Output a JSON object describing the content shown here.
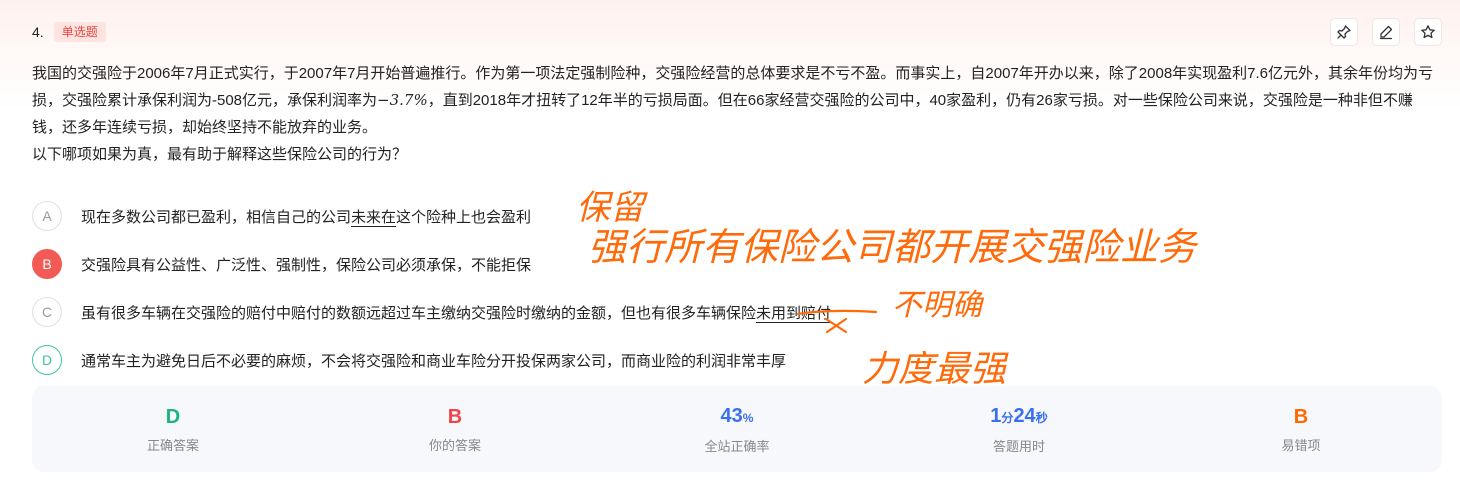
{
  "question": {
    "number": "4.",
    "type": "单选题",
    "stem_before_math": "我国的交强险于2006年7月正式实行，于2007年7月开始普遍推行。作为第一项法定强制险种，交强险经营的总体要求是不亏不盈。而事实上，自2007年开办以来，除了2008年实现盈利7.6亿元外，其余年份均为亏损，交强险累计承保利润为-508亿元，承保利润率为",
    "stem_math": "−3.7%",
    "stem_after_math": "，直到2018年才扭转了12年半的亏损局面。但在66家经营交强险的公司中，40家盈利，仍有26家亏损。对一些保险公司来说，交强险是一种非但不赚钱，还多年连续亏损，却始终坚持不能放弃的业务。",
    "prompt": "以下哪项如果为真，最有助于解释这些保险公司的行为？"
  },
  "options": [
    {
      "letter": "A",
      "text_pre": "现在多数公司都已盈利，相信自己的公司",
      "text_ul": "未来在",
      "text_post": "这个险种上也会盈利",
      "state": "normal"
    },
    {
      "letter": "B",
      "text_pre": "交强险具有公益性、广泛性、强制性，保险公司必须承保，不能拒保",
      "text_ul": "",
      "text_post": "",
      "state": "wrong"
    },
    {
      "letter": "C",
      "text_pre": "虽有很多车辆在交强险的赔付中赔付的数额远超过车主缴纳交强险时缴纳的金额，但也有很多车辆保险",
      "text_ul": "未用到赔付",
      "text_post": "",
      "state": "normal"
    },
    {
      "letter": "D",
      "text_pre": "通常车主为避免日后不必要的麻烦，不会将交强险和商业车险分开投保两家公司，而商业险的利润非常丰厚",
      "text_ul": "",
      "text_post": "",
      "state": "correct"
    }
  ],
  "stats": {
    "correct_answer": {
      "value": "D",
      "label": "正确答案"
    },
    "your_answer": {
      "value": "B",
      "label": "你的答案"
    },
    "accuracy": {
      "value": "43",
      "unit": "%",
      "label": "全站正确率"
    },
    "time_used": {
      "min": "1",
      "min_unit": "分",
      "sec": "24",
      "sec_unit": "秒",
      "label": "答题用时"
    },
    "common_wrong": {
      "value": "B",
      "label": "易错项"
    }
  },
  "annotations": {
    "note_a": "保留",
    "note_b": "强行所有保险公司都开展交强险业务",
    "note_c": "不明确",
    "note_d": "力度最强"
  },
  "icons": {
    "pin": "pin-icon",
    "edit": "pencil-icon",
    "star": "star-icon"
  },
  "colors": {
    "wrong": "#f25b55",
    "correct": "#3fc3a5",
    "ink": "#ff6a0a",
    "accent_blue": "#3a6ff0"
  }
}
